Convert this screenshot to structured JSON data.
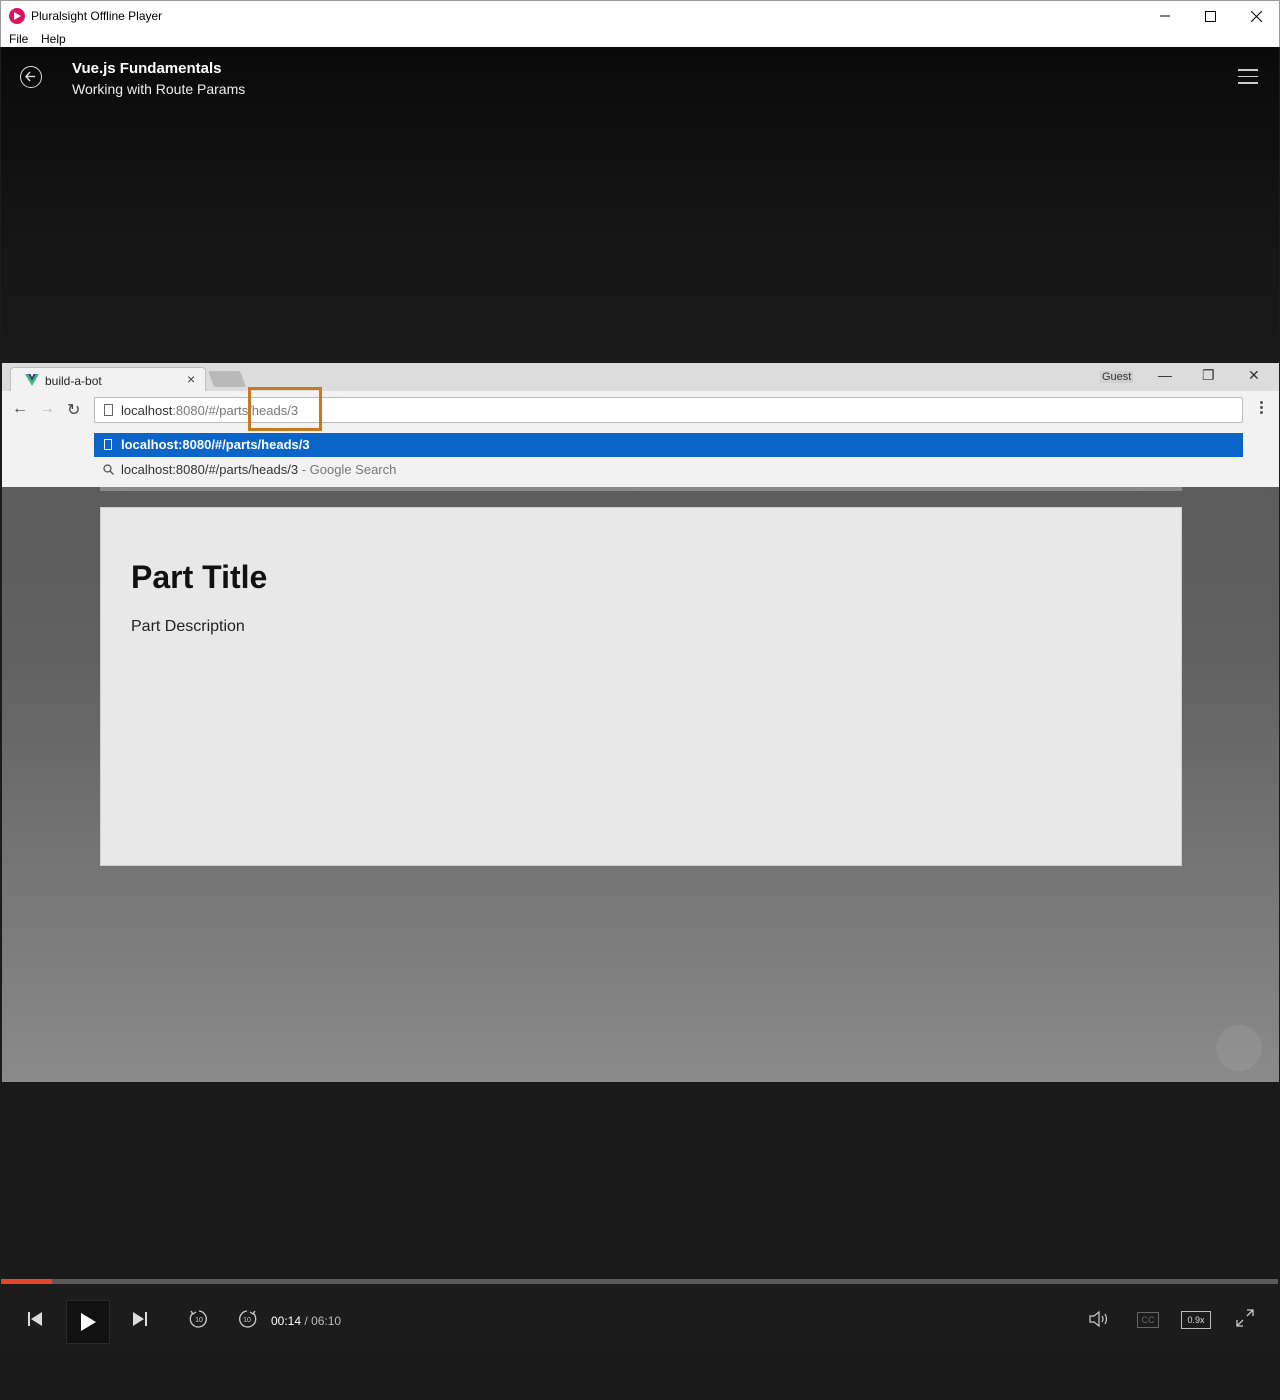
{
  "window": {
    "title": "Pluralsight Offline Player",
    "menu": {
      "file": "File",
      "help": "Help"
    }
  },
  "header": {
    "course_title": "Vue.js Fundamentals",
    "clip_title": "Working with Route Params"
  },
  "video_browser": {
    "tab_title": "build-a-bot",
    "tab_close": "×",
    "profile_label": "Guest",
    "address_host": "localhost",
    "address_rest": ":8080/#/parts/heads/3",
    "suggestion_primary": "localhost:8080/#/parts/heads/3",
    "suggestion_search": "localhost:8080/#/parts/heads/3",
    "suggestion_search_suffix": " - Google Search",
    "page_title": "Part Title",
    "page_description": "Part Description"
  },
  "player": {
    "current_time": "00:14",
    "separator": "/",
    "duration": "06:10",
    "progress_fraction": 0.04,
    "cc_label": "CC",
    "speed_label": "0.9x",
    "accent_color": "#e5452b"
  }
}
